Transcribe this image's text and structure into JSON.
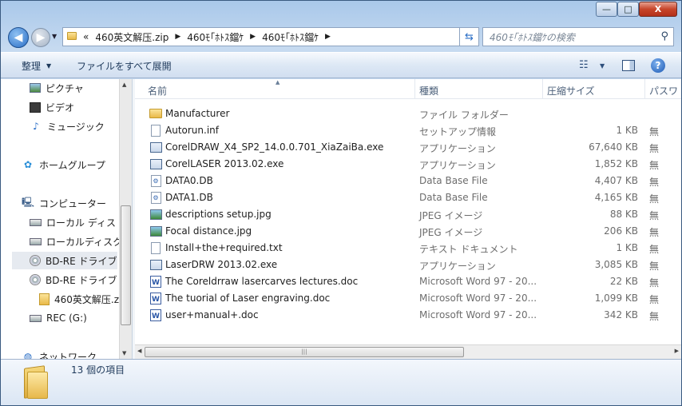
{
  "window": {
    "min_label": "—",
    "max_label": "□",
    "close_label": "X"
  },
  "nav": {
    "back_glyph": "◀",
    "forward_glyph": "▶"
  },
  "address": {
    "overflow": "«",
    "crumbs": [
      "460英文解压.zip",
      "460ﾓ｢ﾎﾄｽ鐺ｹ",
      "460ﾓ｢ﾎﾄｽ鐺ｹ"
    ],
    "separator": "▶"
  },
  "search": {
    "placeholder": "460ﾓ｢ﾎﾄｽ鐺ｹの検索"
  },
  "toolbar": {
    "organize": "整理",
    "extract_all": "ファイルをすべて展開"
  },
  "navpane": {
    "items": [
      {
        "label": "ピクチャ",
        "icon": "pictures-icon"
      },
      {
        "label": "ビデオ",
        "icon": "videos-icon"
      },
      {
        "label": "ミュージック",
        "icon": "music-icon"
      },
      {
        "label": "ホームグループ",
        "icon": "homegroup-icon"
      },
      {
        "label": "コンピューター",
        "icon": "computer-icon"
      },
      {
        "label": "ローカル ディス",
        "icon": "local-disk-icon"
      },
      {
        "label": "ローカルディスク",
        "icon": "local-disk-icon"
      },
      {
        "label": "BD-RE ドライブ",
        "icon": "bd-drive-icon"
      },
      {
        "label": "BD-RE ドライブ",
        "icon": "bd-drive-icon"
      },
      {
        "label": "460英文解压.z",
        "icon": "zip-folder-icon"
      },
      {
        "label": "REC (G:)",
        "icon": "drive-icon"
      },
      {
        "label": "ネットワーク",
        "icon": "network-icon"
      }
    ]
  },
  "columns": {
    "name": "名前",
    "type": "種類",
    "compressed_size": "圧縮サイズ",
    "password": "パスワ"
  },
  "files": [
    {
      "name": "Manufacturer",
      "type": "ファイル フォルダー",
      "size": "",
      "enc": "",
      "icon": "folder"
    },
    {
      "name": "Autorun.inf",
      "type": "セットアップ情報",
      "size": "1 KB",
      "enc": "無",
      "icon": "file"
    },
    {
      "name": "CorelDRAW_X4_SP2_14.0.0.701_XiaZaiBa.exe",
      "type": "アプリケーション",
      "size": "67,640 KB",
      "enc": "無",
      "icon": "exe"
    },
    {
      "name": "CorelLASER 2013.02.exe",
      "type": "アプリケーション",
      "size": "1,852 KB",
      "enc": "無",
      "icon": "exe"
    },
    {
      "name": "DATA0.DB",
      "type": "Data Base File",
      "size": "4,407 KB",
      "enc": "無",
      "icon": "db"
    },
    {
      "name": "DATA1.DB",
      "type": "Data Base File",
      "size": "4,165 KB",
      "enc": "無",
      "icon": "db"
    },
    {
      "name": "descriptions setup.jpg",
      "type": "JPEG イメージ",
      "size": "88 KB",
      "enc": "無",
      "icon": "img"
    },
    {
      "name": "Focal distance.jpg",
      "type": "JPEG イメージ",
      "size": "206 KB",
      "enc": "無",
      "icon": "img"
    },
    {
      "name": "Install+the+required.txt",
      "type": "テキスト ドキュメント",
      "size": "1 KB",
      "enc": "無",
      "icon": "file"
    },
    {
      "name": "LaserDRW 2013.02.exe",
      "type": "アプリケーション",
      "size": "3,085 KB",
      "enc": "無",
      "icon": "exe"
    },
    {
      "name": "The Coreldrraw lasercarves lectures.doc",
      "type": "Microsoft Word 97 - 20...",
      "size": "22 KB",
      "enc": "無",
      "icon": "doc"
    },
    {
      "name": "The tuorial of Laser engraving.doc",
      "type": "Microsoft Word 97 - 20...",
      "size": "1,099 KB",
      "enc": "無",
      "icon": "doc"
    },
    {
      "name": "user+manual+.doc",
      "type": "Microsoft Word 97 - 20...",
      "size": "342 KB",
      "enc": "無",
      "icon": "doc"
    }
  ],
  "details": {
    "item_count": "13 個の項目"
  }
}
